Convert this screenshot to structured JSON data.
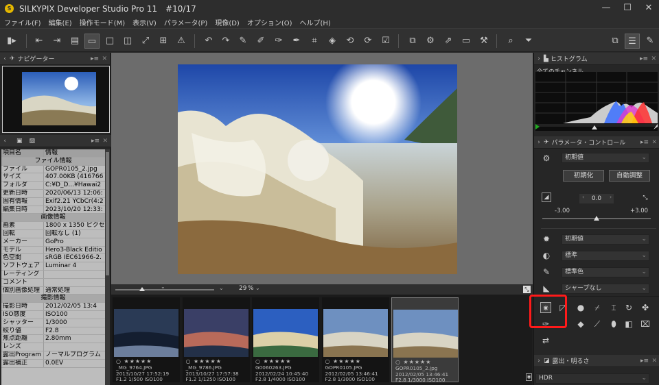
{
  "window": {
    "title": "SILKYPIX Developer Studio Pro 11　#10/17",
    "logo_letter": "S",
    "minimize": "—",
    "maximize": "☐",
    "close": "✕"
  },
  "menu": [
    "ファイル(F)",
    "編集(E)",
    "操作モード(M)",
    "表示(V)",
    "パラメータ(P)",
    "現像(D)",
    "オプション(O)",
    "ヘルプ(H)"
  ],
  "navigator": {
    "title": "ナビゲーター"
  },
  "info_panel": {
    "col_item": "項目名",
    "col_info": "情報",
    "rows": [
      {
        "section": "ファイル情報"
      },
      {
        "k": "ファイル",
        "v": "GOPR0105_2.jpg"
      },
      {
        "k": "サイズ",
        "v": "407.00KB (416766"
      },
      {
        "k": "フォルダ",
        "v": "C:¥D_D...¥Hawai2"
      },
      {
        "k": "更新日時",
        "v": "2020/06/13 12:06:"
      },
      {
        "k": "固有情報",
        "v": "Exif2.21 YCbCr(4:2"
      },
      {
        "k": "編集日時",
        "v": "2023/10/20 12:33:"
      },
      {
        "section": "画像情報"
      },
      {
        "k": "画素",
        "v": "1800 x 1350 ピクセ"
      },
      {
        "k": "回転",
        "v": "回転なし (1)"
      },
      {
        "k": "メーカー",
        "v": "GoPro"
      },
      {
        "k": "モデル",
        "v": "Hero3-Black Editio"
      },
      {
        "k": "色空間",
        "v": "sRGB IEC61966-2."
      },
      {
        "k": "ソフトウェア",
        "v": "Luminar 4"
      },
      {
        "k": "レーティング",
        "v": ""
      },
      {
        "k": "コメント",
        "v": ""
      },
      {
        "k": "個別画像処理",
        "v": "通常処理"
      },
      {
        "section": "撮影情報"
      },
      {
        "k": "撮影日時",
        "v": "2012/02/05 13:4"
      },
      {
        "k": "ISO感度",
        "v": "ISO100"
      },
      {
        "k": "シャッター",
        "v": "1/3000"
      },
      {
        "k": "絞り値",
        "v": "F2.8"
      },
      {
        "k": "焦点距離",
        "v": "2.80mm"
      },
      {
        "k": "レンズ",
        "v": ""
      },
      {
        "k": "露出Program",
        "v": "ノーマルプログラム"
      },
      {
        "k": "露出補正",
        "v": "0.0EV"
      }
    ]
  },
  "viewer": {
    "zoom_value": "29",
    "zoom_unit": "%"
  },
  "filmstrip": [
    {
      "name": "_MG_9764.JPG",
      "date": "2013/10/27 17:52:19",
      "exif": "F1.2 1/500 ISO100",
      "selected": false
    },
    {
      "name": "_MG_9786.JPG",
      "date": "2013/10/27 17:57:38",
      "exif": "F1.2 1/1250 ISO100",
      "selected": false
    },
    {
      "name": "G0060263.JPG",
      "date": "2012/02/24 10:45:40",
      "exif": "F2.8 1/4000 ISO100",
      "selected": false
    },
    {
      "name": "GOPR0105.JPG",
      "date": "2012/02/05 13:46:41",
      "exif": "F2.8 1/3000 ISO100",
      "selected": false
    },
    {
      "name": "GOPR0105_2.jpg",
      "date": "2012/02/05 13:46:41",
      "exif": "F2.8 1/3000 ISO100",
      "selected": true
    }
  ],
  "film_rating": "○ ★★★★★",
  "histogram": {
    "title": "ヒストグラム",
    "channel": "全てのチャンネル"
  },
  "params": {
    "title": "パラメータ・コントロール",
    "preset": "初期値",
    "init_btn": "初期化",
    "auto_btn": "自動調整",
    "exposure_value": "0.0",
    "range_min": "-3.00",
    "range_max": "+3.00",
    "exposure_level": 0.5,
    "wb": "初期値",
    "tone": "標準",
    "color": "標準色",
    "sharp": "シャープなし"
  },
  "exposure_panel": {
    "title": "露出・明るさ",
    "hdr": "HDR"
  }
}
